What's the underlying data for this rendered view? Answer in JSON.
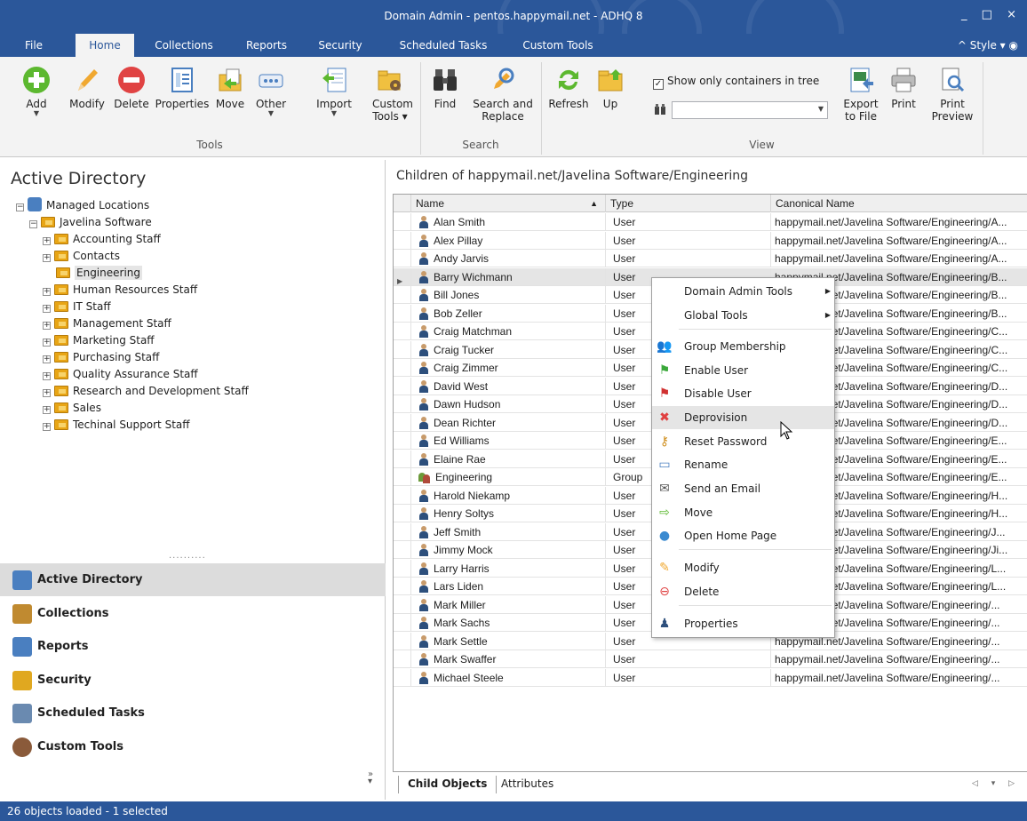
{
  "window": {
    "title": "Domain Admin - pentos.happymail.net - ADHQ 8",
    "controls": "_ □ ×"
  },
  "menu": {
    "tabs": [
      "File",
      "Home",
      "Collections",
      "Reports",
      "Security",
      "Scheduled Tasks",
      "Custom Tools"
    ],
    "active_tab": "Home",
    "style_label": "^ Style ▾"
  },
  "ribbon": {
    "tools": {
      "add": "Add",
      "modify": "Modify",
      "delete": "Delete",
      "properties": "Properties",
      "move": "Move",
      "other": "Other",
      "import": "Import",
      "custom_tools": "Custom Tools ▾",
      "group_label": "Tools"
    },
    "search": {
      "find": "Find",
      "search_replace": "Search and Replace",
      "group_label": "Search"
    },
    "view": {
      "refresh": "Refresh",
      "up": "Up",
      "show_containers": "Show only containers in tree",
      "show_containers_checked": true,
      "filter_value": "",
      "export": "Export to File",
      "print": "Print",
      "print_preview": "Print Preview",
      "group_label": "View"
    }
  },
  "left": {
    "title": "Active Directory",
    "tree": [
      {
        "label": "Managed Locations",
        "level": 0,
        "expander": "−",
        "icon": "managed-locations-icon"
      },
      {
        "label": "Javelina Software",
        "level": 1,
        "expander": "−",
        "icon": "folder-icon"
      },
      {
        "label": "Accounting Staff",
        "level": 2,
        "expander": "+",
        "icon": "folder-icon"
      },
      {
        "label": "Contacts",
        "level": 2,
        "expander": "+",
        "icon": "folder-icon"
      },
      {
        "label": "Engineering",
        "level": 2,
        "expander": "",
        "icon": "folder-icon",
        "selected": true
      },
      {
        "label": "Human Resources Staff",
        "level": 2,
        "expander": "+",
        "icon": "folder-icon"
      },
      {
        "label": "IT Staff",
        "level": 2,
        "expander": "+",
        "icon": "folder-icon"
      },
      {
        "label": "Management Staff",
        "level": 2,
        "expander": "+",
        "icon": "folder-icon"
      },
      {
        "label": "Marketing Staff",
        "level": 2,
        "expander": "+",
        "icon": "folder-icon"
      },
      {
        "label": "Purchasing Staff",
        "level": 2,
        "expander": "+",
        "icon": "folder-icon"
      },
      {
        "label": "Quality Assurance Staff",
        "level": 2,
        "expander": "+",
        "icon": "folder-icon"
      },
      {
        "label": "Research and Development Staff",
        "level": 2,
        "expander": "+",
        "icon": "folder-icon"
      },
      {
        "label": "Sales",
        "level": 2,
        "expander": "+",
        "icon": "folder-icon"
      },
      {
        "label": "Techinal Support Staff",
        "level": 2,
        "expander": "+",
        "icon": "folder-icon"
      }
    ],
    "splitter": "..........",
    "nav": [
      {
        "label": "Active Directory",
        "icon": "active-directory-icon",
        "active": true
      },
      {
        "label": "Collections",
        "icon": "collections-icon"
      },
      {
        "label": "Reports",
        "icon": "reports-icon"
      },
      {
        "label": "Security",
        "icon": "security-lock-icon"
      },
      {
        "label": "Scheduled Tasks",
        "icon": "scheduled-tasks-icon"
      },
      {
        "label": "Custom Tools",
        "icon": "custom-tools-icon"
      }
    ],
    "nav_more": "»"
  },
  "right": {
    "title": "Children of happymail.net/Javelina Software/Engineering",
    "columns": {
      "name": "Name",
      "type": "Type",
      "canonical": "Canonical Name",
      "sort_indicator": "▲"
    },
    "rows": [
      {
        "name": "Alan Smith",
        "type": "User",
        "canonical": "happymail.net/Javelina Software/Engineering/A..."
      },
      {
        "name": "Alex Pillay",
        "type": "User",
        "canonical": "happymail.net/Javelina Software/Engineering/A..."
      },
      {
        "name": "Andy Jarvis",
        "type": "User",
        "canonical": "happymail.net/Javelina Software/Engineering/A..."
      },
      {
        "name": "Barry Wichmann",
        "type": "User",
        "canonical": "happymail.net/Javelina Software/Engineering/B...",
        "selected": true
      },
      {
        "name": "Bill Jones",
        "type": "User",
        "canonical": "happymail.net/Javelina Software/Engineering/B..."
      },
      {
        "name": "Bob Zeller",
        "type": "User",
        "canonical": "happymail.net/Javelina Software/Engineering/B..."
      },
      {
        "name": "Craig Matchman",
        "type": "User",
        "canonical": "happymail.net/Javelina Software/Engineering/C..."
      },
      {
        "name": "Craig Tucker",
        "type": "User",
        "canonical": "happymail.net/Javelina Software/Engineering/C..."
      },
      {
        "name": "Craig Zimmer",
        "type": "User",
        "canonical": "happymail.net/Javelina Software/Engineering/C..."
      },
      {
        "name": "David West",
        "type": "User",
        "canonical": "happymail.net/Javelina Software/Engineering/D..."
      },
      {
        "name": "Dawn Hudson",
        "type": "User",
        "canonical": "happymail.net/Javelina Software/Engineering/D..."
      },
      {
        "name": "Dean Richter",
        "type": "User",
        "canonical": "happymail.net/Javelina Software/Engineering/D..."
      },
      {
        "name": "Ed Williams",
        "type": "User",
        "canonical": "happymail.net/Javelina Software/Engineering/E..."
      },
      {
        "name": "Elaine Rae",
        "type": "User",
        "canonical": "happymail.net/Javelina Software/Engineering/E..."
      },
      {
        "name": "Engineering",
        "type": "Group",
        "canonical": "happymail.net/Javelina Software/Engineering/E..."
      },
      {
        "name": "Harold Niekamp",
        "type": "User",
        "canonical": "happymail.net/Javelina Software/Engineering/H..."
      },
      {
        "name": "Henry Soltys",
        "type": "User",
        "canonical": "happymail.net/Javelina Software/Engineering/H..."
      },
      {
        "name": "Jeff Smith",
        "type": "User",
        "canonical": "happymail.net/Javelina Software/Engineering/J..."
      },
      {
        "name": "Jimmy Mock",
        "type": "User",
        "canonical": "happymail.net/Javelina Software/Engineering/Ji..."
      },
      {
        "name": "Larry Harris",
        "type": "User",
        "canonical": "happymail.net/Javelina Software/Engineering/L..."
      },
      {
        "name": "Lars Liden",
        "type": "User",
        "canonical": "happymail.net/Javelina Software/Engineering/L..."
      },
      {
        "name": "Mark Miller",
        "type": "User",
        "canonical": "happymail.net/Javelina Software/Engineering/..."
      },
      {
        "name": "Mark Sachs",
        "type": "User",
        "canonical": "happymail.net/Javelina Software/Engineering/..."
      },
      {
        "name": "Mark Settle",
        "type": "User",
        "canonical": "happymail.net/Javelina Software/Engineering/..."
      },
      {
        "name": "Mark Swaffer",
        "type": "User",
        "canonical": "happymail.net/Javelina Software/Engineering/..."
      },
      {
        "name": "Michael Steele",
        "type": "User",
        "canonical": "happymail.net/Javelina Software/Engineering/..."
      }
    ],
    "tabs": {
      "child_objects": "Child Objects",
      "attributes": "Attributes",
      "nav": "◁ ▾ ▷"
    }
  },
  "context_menu": {
    "items": [
      {
        "label": "Domain Admin Tools",
        "icon": "",
        "submenu": true
      },
      {
        "label": "Global Tools",
        "icon": "",
        "submenu": true
      },
      {
        "label": "Group Membership",
        "icon": "group-membership-icon"
      },
      {
        "label": "Enable User",
        "icon": "green-flag-icon"
      },
      {
        "label": "Disable User",
        "icon": "red-flag-icon"
      },
      {
        "label": "Deprovision",
        "icon": "red-x-icon",
        "highlighted": true
      },
      {
        "label": "Reset Password",
        "icon": "key-icon"
      },
      {
        "label": "Rename",
        "icon": "rename-icon"
      },
      {
        "label": "Send an Email",
        "icon": "mailbox-icon"
      },
      {
        "label": "Move",
        "icon": "move-icon"
      },
      {
        "label": "Open Home Page",
        "icon": "globe-icon"
      },
      {
        "label": "Modify",
        "icon": "pencil-icon"
      },
      {
        "label": "Delete",
        "icon": "delete-icon"
      },
      {
        "label": "Properties",
        "icon": "user-properties-icon"
      }
    ],
    "submenu_arrow": "▶"
  },
  "status": {
    "text": "26 objects loaded - 1 selected"
  },
  "colors": {
    "brand": "#2b579a",
    "ribbon_bg": "#f3f3f3",
    "selection": "#e5e5e5",
    "folder": "#e8a515"
  }
}
